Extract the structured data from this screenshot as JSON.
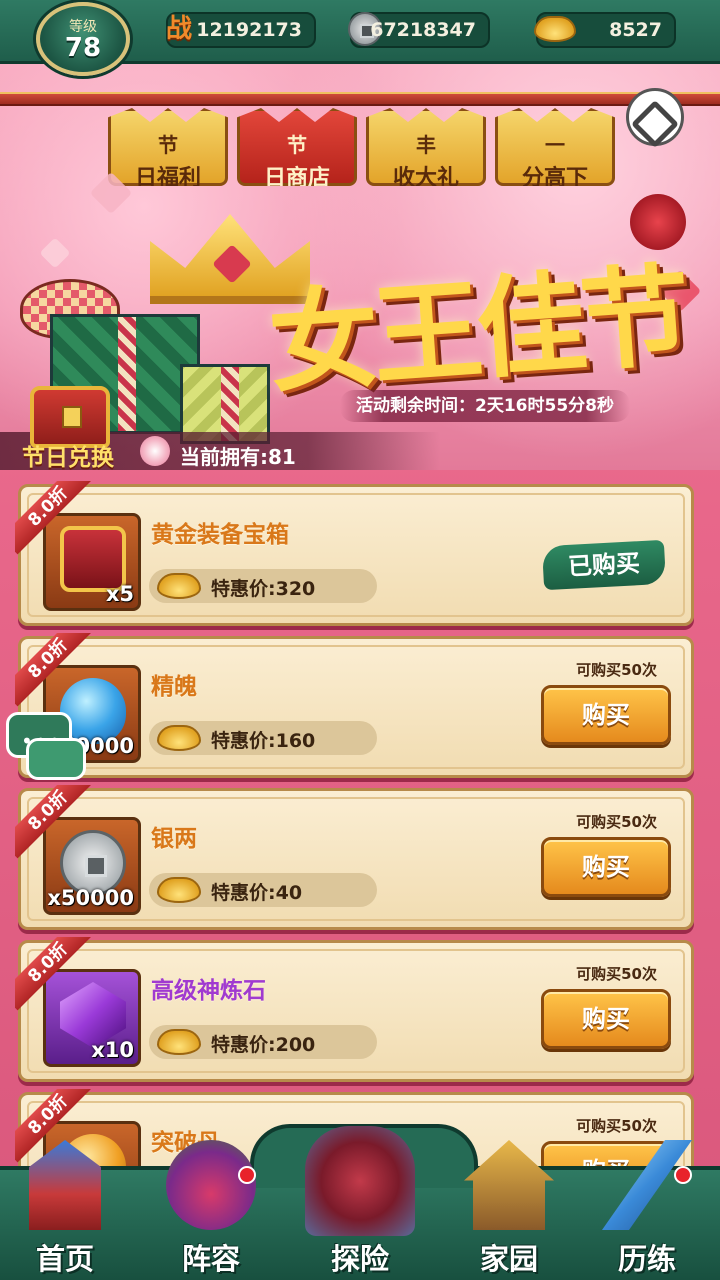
{
  "topbar": {
    "level_label": "等级",
    "level_value": "78",
    "power_icon_char": "战",
    "power": "12192173",
    "silver": "67218347",
    "gold": "8527"
  },
  "banner": {
    "tabs": [
      {
        "line1": "节",
        "line2": "日福利"
      },
      {
        "line1": "节",
        "line2": "日商店",
        "active": true
      },
      {
        "line1": "丰",
        "line2": "收大礼"
      },
      {
        "line1": "一",
        "line2": "分高下"
      }
    ],
    "event_title": "女王佳节",
    "countdown": "活动剩余时间：2天16时55分8秒",
    "exchange_label": "节日兑换",
    "owned_text": "当前拥有:81"
  },
  "shop": {
    "items": [
      {
        "discount": "8.0折",
        "name": "黄金装备宝箱",
        "qty": "x5",
        "price": "特惠价:320",
        "state": "已购买"
      },
      {
        "discount": "8.0折",
        "name": "精魄",
        "qty": "x50000",
        "price": "特惠价:160",
        "limit": "可购买50次",
        "button": "购买"
      },
      {
        "discount": "8.0折",
        "name": "银两",
        "qty": "x50000",
        "price": "特惠价:40",
        "limit": "可购买50次",
        "button": "购买"
      },
      {
        "discount": "8.0折",
        "name": "高级神炼石",
        "qty": "x10",
        "price": "特惠价:200",
        "limit": "可购买50次",
        "button": "购买"
      },
      {
        "discount": "8.0折",
        "name": "突破丹",
        "limit": "可购买50次",
        "button": "购买"
      }
    ]
  },
  "nav": {
    "items": [
      {
        "label": "首页",
        "icon": "palace-gate-icon"
      },
      {
        "label": "阵容",
        "icon": "gourd-team-icon"
      },
      {
        "label": "探险",
        "icon": "portal-icon"
      },
      {
        "label": "家园",
        "icon": "house-icon"
      },
      {
        "label": "历练",
        "icon": "sword-icon"
      }
    ]
  },
  "colors": {
    "accent_green": "#2f7a63",
    "banner_pink": "#f193b0",
    "gold": "#ffd84a",
    "buy_orange": "#e58a1d"
  }
}
